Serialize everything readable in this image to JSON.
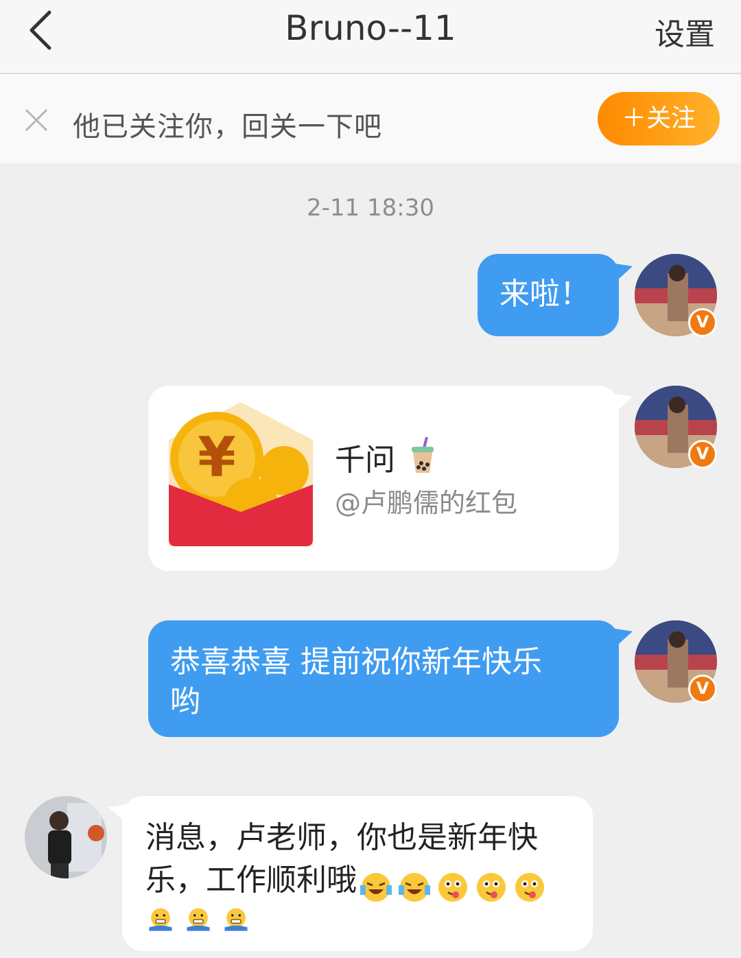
{
  "header": {
    "title": "Bruno--11",
    "settings_label": "设置"
  },
  "follow_notice": {
    "text": "他已关注你，回关一下吧",
    "button_label": "＋关注"
  },
  "chat": {
    "timestamp": "2-11 18:30",
    "messages": [
      {
        "text": "来啦！"
      },
      {
        "red_packet": {
          "name": "千问",
          "subtitle": "@卢鹏儒的红包"
        }
      },
      {
        "text_line1": "恭喜恭喜 提前祝你新年快乐",
        "text_line2": "哟"
      },
      {
        "text_line1": "消息，卢老师，你也是新年快",
        "text_line2": "乐，工作顺利哦"
      }
    ]
  },
  "verified_badge": "V",
  "colors": {
    "accent_orange": "#ff8a00",
    "bubble_blue": "#3f9cf1",
    "background": "#efefef"
  }
}
